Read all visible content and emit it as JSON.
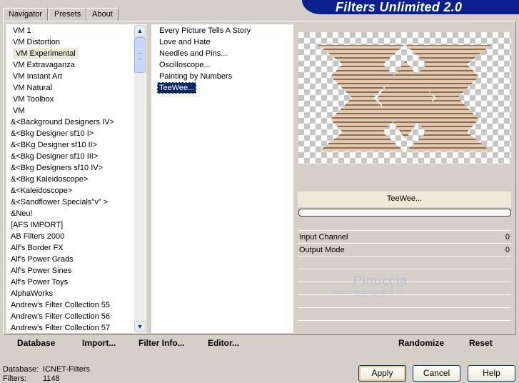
{
  "app": {
    "title": "Filters Unlimited 2.0"
  },
  "tabs": [
    {
      "label": "Navigator",
      "active": true
    },
    {
      "label": "Presets",
      "active": false
    },
    {
      "label": "About",
      "active": false
    }
  ],
  "categories": [
    "VM 1",
    "VM Distortion",
    "VM Experimental",
    "VM Extravaganza",
    "VM Instant Art",
    "VM Natural",
    "VM Toolbox",
    "VM",
    "&<Background Designers IV>",
    "&<Bkg Designer sf10 I>",
    "&<BKg Designer sf10 II>",
    "&<Bkg Designer sf10 III>",
    "&<Bkg Designers sf10 IV>",
    "&<Bkg Kaleidoscope>",
    "&<Kaleidoscope>",
    "&<Sandflower Specials\"v\" >",
    "&Neu!",
    "[AFS IMPORT]",
    "AB Filters 2000",
    "Alf's Border FX",
    "Alf's Power Grads",
    "Alf's Power Sines",
    "Alf's Power Toys",
    "AlphaWorks",
    "Andrew's Filter Collection 55",
    "Andrew's Filter Collection 56",
    "Andrew's Filter Collection 57"
  ],
  "selected_category": "VM Experimental",
  "filters": [
    "Every Picture Tells A Story",
    "Love and Hate",
    "Needles and Pins...",
    "Oscilloscope...",
    "Painting by Numbers",
    "TeeWee..."
  ],
  "selected_filter": "TeeWee...",
  "preview": {
    "filter_name": "TeeWee...",
    "shape_color": "#e8c8a8",
    "line_color": "#1a1a1a"
  },
  "params": [
    {
      "label": "Input Channel",
      "value": "0"
    },
    {
      "label": "Output Mode",
      "value": "0"
    }
  ],
  "actions": {
    "database": "Database",
    "import": "Import...",
    "filter_info": "Filter Info...",
    "editor": "Editor...",
    "randomize": "Randomize",
    "reset": "Reset"
  },
  "status": {
    "database_label": "Database:",
    "database_value": "ICNET-Filters",
    "filters_label": "Filters:",
    "filters_value": "1148"
  },
  "buttons": {
    "apply": "Apply",
    "cancel": "Cancel",
    "help": "Help"
  },
  "watermark": {
    "name": "Pinuccia",
    "url": "www.maidiregrafica.eu"
  }
}
